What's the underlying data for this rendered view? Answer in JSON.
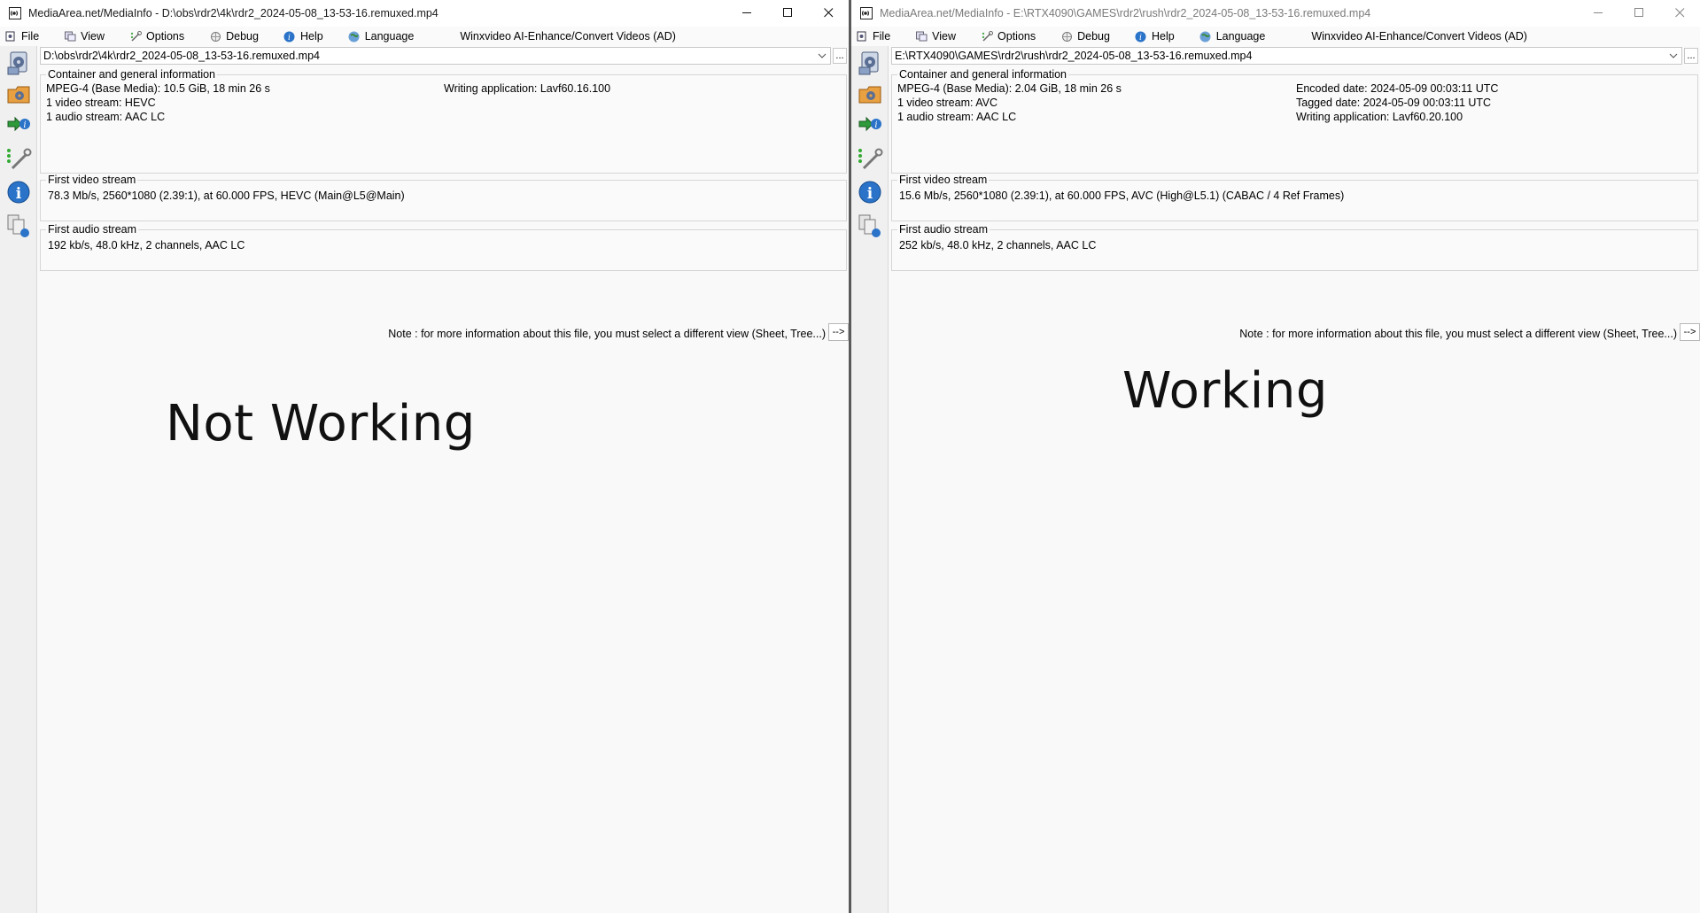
{
  "left_window": {
    "title": "MediaArea.net/MediaInfo - D:\\obs\\rdr2\\4k\\rdr2_2024-05-08_13-53-16.remuxed.mp4",
    "path_value": "D:\\obs\\rdr2\\4k\\rdr2_2024-05-08_13-53-16.remuxed.mp4",
    "browse_label": "...",
    "menu": {
      "file": "File",
      "view": "View",
      "options": "Options",
      "debug": "Debug",
      "help": "Help",
      "language": "Language",
      "ad": "Winxvideo AI-Enhance/Convert Videos (AD)"
    },
    "general": {
      "title": "Container and general information",
      "line1": "MPEG-4 (Base Media): 10.5 GiB, 18 min 26 s",
      "line2": "1 video stream: HEVC",
      "line3": "1 audio stream: AAC LC",
      "right1": "Writing application: Lavf60.16.100"
    },
    "video": {
      "title": "First video stream",
      "line1": "78.3 Mb/s, 2560*1080 (2.39:1), at 60.000 FPS, HEVC (Main@L5@Main)"
    },
    "audio": {
      "title": "First audio stream",
      "line1": "192 kb/s, 48.0 kHz, 2 channels, AAC LC"
    },
    "note": "Note : for more information about this file, you must select a different view (Sheet, Tree...)",
    "next_label": "-->",
    "overlay": "Not Working"
  },
  "right_window": {
    "title": "MediaArea.net/MediaInfo - E:\\RTX4090\\GAMES\\rdr2\\rush\\rdr2_2024-05-08_13-53-16.remuxed.mp4",
    "path_value": "E:\\RTX4090\\GAMES\\rdr2\\rush\\rdr2_2024-05-08_13-53-16.remuxed.mp4",
    "browse_label": "...",
    "menu": {
      "file": "File",
      "view": "View",
      "options": "Options",
      "debug": "Debug",
      "help": "Help",
      "language": "Language",
      "ad": "Winxvideo AI-Enhance/Convert Videos (AD)"
    },
    "general": {
      "title": "Container and general information",
      "line1": "MPEG-4 (Base Media): 2.04 GiB, 18 min 26 s",
      "line2": "1 video stream: AVC",
      "line3": "1 audio stream: AAC LC",
      "right1": "Encoded date: 2024-05-09 00:03:11 UTC",
      "right2": "Tagged date: 2024-05-09 00:03:11 UTC",
      "right3": "Writing application: Lavf60.20.100"
    },
    "video": {
      "title": "First video stream",
      "line1": "15.6 Mb/s, 2560*1080 (2.39:1), at 60.000 FPS, AVC (High@L5.1) (CABAC / 4 Ref Frames)"
    },
    "audio": {
      "title": "First audio stream",
      "line1": "252 kb/s, 48.0 kHz, 2 channels, AAC LC"
    },
    "note": "Note : for more information about this file, you must select a different view (Sheet, Tree...)",
    "next_label": "-->",
    "overlay": "Working"
  },
  "icons": {
    "app": "mediainfo-app-icon",
    "minimize": "minimize-icon",
    "maximize": "maximize-icon",
    "close": "close-icon",
    "sidebar": [
      "open-file-icon",
      "open-folder-icon",
      "export-icon",
      "settings-icon",
      "about-icon",
      "copy-icon"
    ]
  }
}
